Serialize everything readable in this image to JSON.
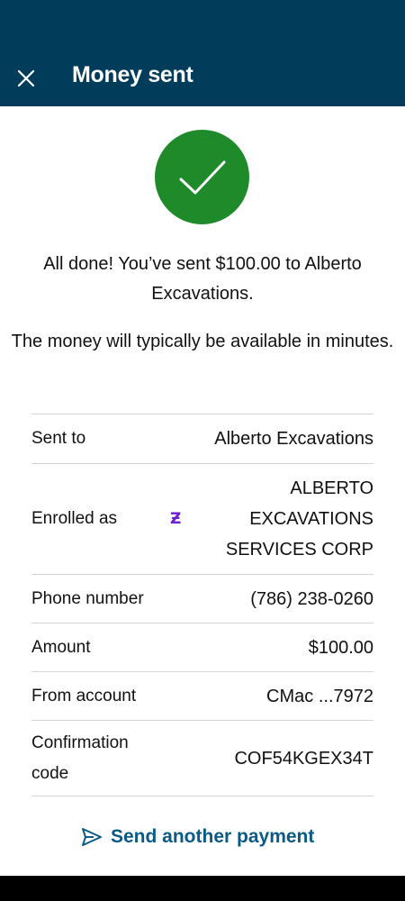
{
  "header": {
    "title": "Money sent",
    "close_icon": "close-icon",
    "background": "#013d5b"
  },
  "status": {
    "icon": "checkmark-icon",
    "color": "#1e8a2a"
  },
  "message": {
    "line1": "All done! You’ve sent $100.00 to",
    "line2": "Alberto Excavations.",
    "line3": "The money will typically be",
    "line4": "available in minutes."
  },
  "details": {
    "sent_to": {
      "label": "Sent to",
      "value": "Alberto Excavations"
    },
    "enrolled_as": {
      "label": "Enrolled as",
      "value_lines": [
        "ALBERTO",
        "EXCAVATIONS",
        "SERVICES CORP"
      ],
      "icon": "zelle-icon",
      "icon_glyph": "Ƶ"
    },
    "phone": {
      "label": "Phone number",
      "value": "(786) 238-0260"
    },
    "amount": {
      "label": "Amount",
      "value": "$100.00"
    },
    "from_account": {
      "label": "From account",
      "value": "CMac ...7972"
    },
    "confirmation": {
      "label": "Confirmation code",
      "value": "COF54KGEX34T"
    }
  },
  "actions": {
    "send_another_label": "Send another payment",
    "send_icon": "send-icon",
    "accent": "#0b5a86"
  }
}
